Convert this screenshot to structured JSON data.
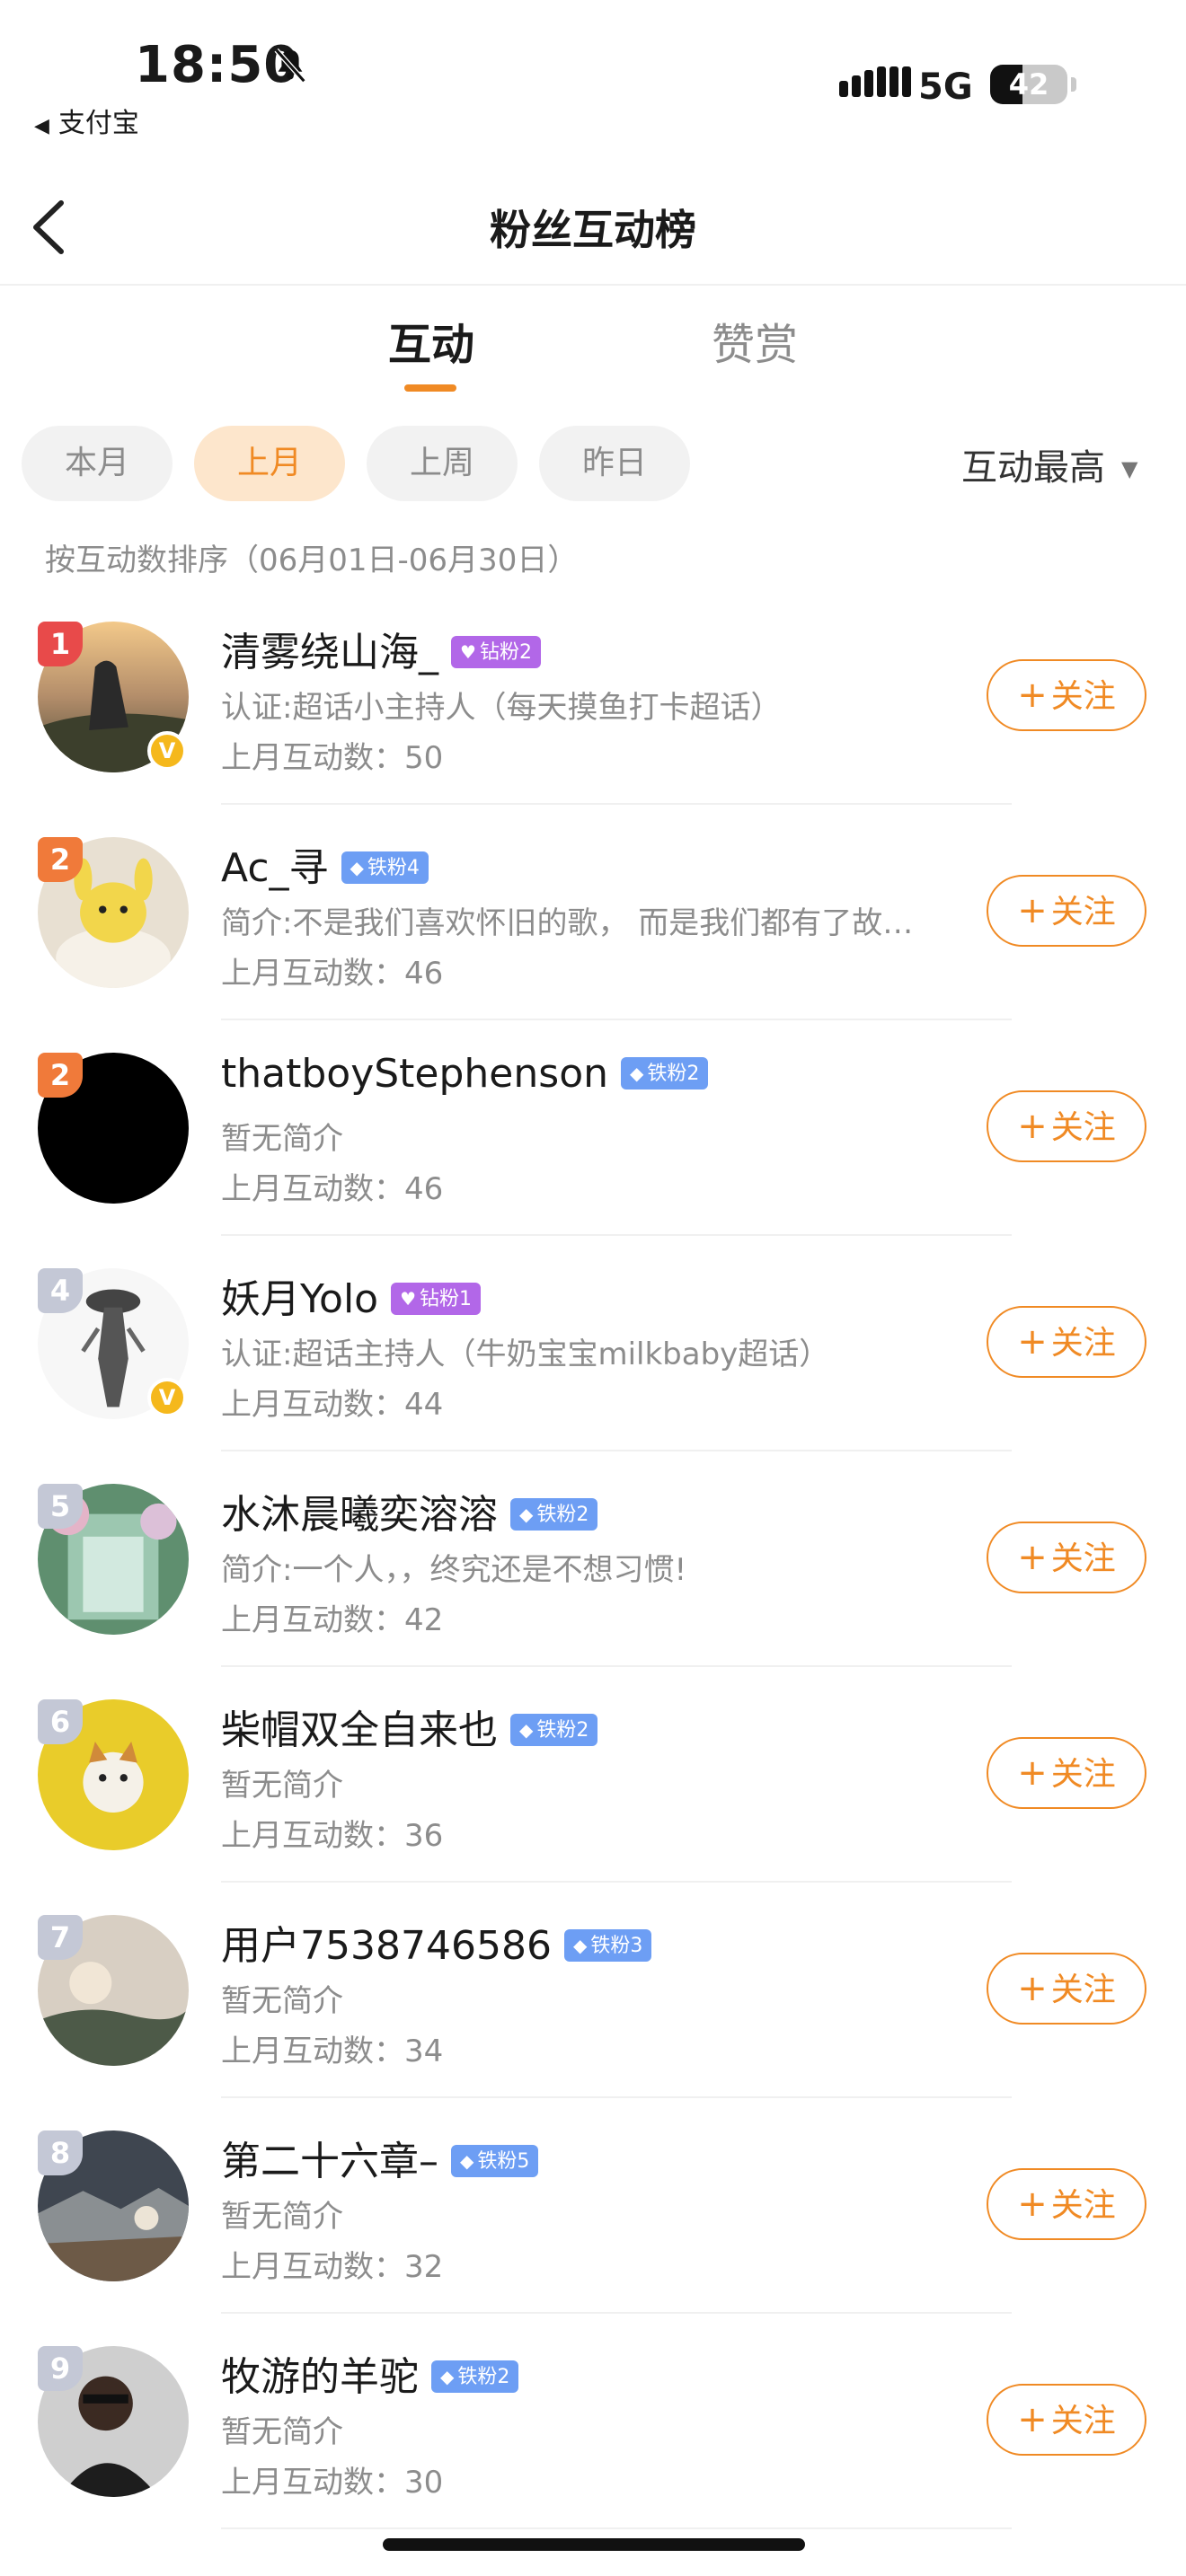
{
  "status_bar": {
    "time": "18:50",
    "back_app": "支付宝",
    "network": "5G",
    "battery": "42",
    "battery_level": 0.42
  },
  "nav": {
    "title": "粉丝互动榜"
  },
  "tabs": [
    {
      "label": "互动",
      "active": true
    },
    {
      "label": "赞赏",
      "active": false
    }
  ],
  "filters": [
    {
      "label": "本月",
      "active": false
    },
    {
      "label": "上月",
      "active": true
    },
    {
      "label": "上周",
      "active": false
    },
    {
      "label": "昨日",
      "active": false
    }
  ],
  "sort": {
    "label": "互动最高"
  },
  "range_text": "按互动数排序（06月01日-06月30日）",
  "follow_label": "关注",
  "colors": {
    "accent": "#f08a24",
    "rank_top": "#e84a4a",
    "rank_mid": "#f07a3a",
    "rank_other": "#c4c8d6",
    "badge_diamond": "#b267e8",
    "badge_iron": "#6d9ef4"
  },
  "list": [
    {
      "rank": "1",
      "name": "清雾绕山海_",
      "badge": "钻粉2",
      "badge_type": "diamond",
      "bio": "认证:超话小主持人（每天摸鱼打卡超话）",
      "count": "上月互动数：50",
      "verified": true,
      "avatar": "sunset-mountain"
    },
    {
      "rank": "2",
      "name": "Ac_寻",
      "badge": "铁粉4",
      "badge_type": "iron",
      "bio": "简介:不是我们喜欢怀旧的歌， 而是我们都有了故…",
      "count": "上月互动数：46",
      "verified": false,
      "avatar": "yellow-plush"
    },
    {
      "rank": "2",
      "name": "thatboyStephenson",
      "badge": "铁粉2",
      "badge_type": "iron",
      "bio": "暂无简介",
      "count": "上月互动数：46",
      "verified": false,
      "avatar": "black"
    },
    {
      "rank": "4",
      "name": "妖月Yolo",
      "badge": "钻粉1",
      "badge_type": "diamond",
      "bio": "认证:超话主持人（牛奶宝宝milkbaby超话）",
      "count": "上月互动数：44",
      "verified": true,
      "avatar": "sketch-figure"
    },
    {
      "rank": "5",
      "name": "水沐晨曦奕溶溶",
      "badge": "铁粉2",
      "badge_type": "iron",
      "bio": "简介:一个人，，终究还是不想习惯!",
      "count": "上月互动数：42",
      "verified": false,
      "avatar": "fantasy-garden"
    },
    {
      "rank": "6",
      "name": "柴帽双全自来也",
      "badge": "铁粉2",
      "badge_type": "iron",
      "bio": "暂无简介",
      "count": "上月互动数：36",
      "verified": false,
      "avatar": "yellow-shiba"
    },
    {
      "rank": "7",
      "name": "用户7538746586",
      "badge": "铁粉3",
      "badge_type": "iron",
      "bio": "暂无简介",
      "count": "上月互动数：34",
      "verified": false,
      "avatar": "hazy-landscape"
    },
    {
      "rank": "8",
      "name": "第二十六章–",
      "badge": "铁粉5",
      "badge_type": "iron",
      "bio": "暂无简介",
      "count": "上月互动数：32",
      "verified": false,
      "avatar": "cloudy-mountain"
    },
    {
      "rank": "9",
      "name": "牧游的羊驼",
      "badge": "铁粉2",
      "badge_type": "iron",
      "bio": "暂无简介",
      "count": "上月互动数：30",
      "verified": false,
      "avatar": "dark-portrait"
    }
  ]
}
